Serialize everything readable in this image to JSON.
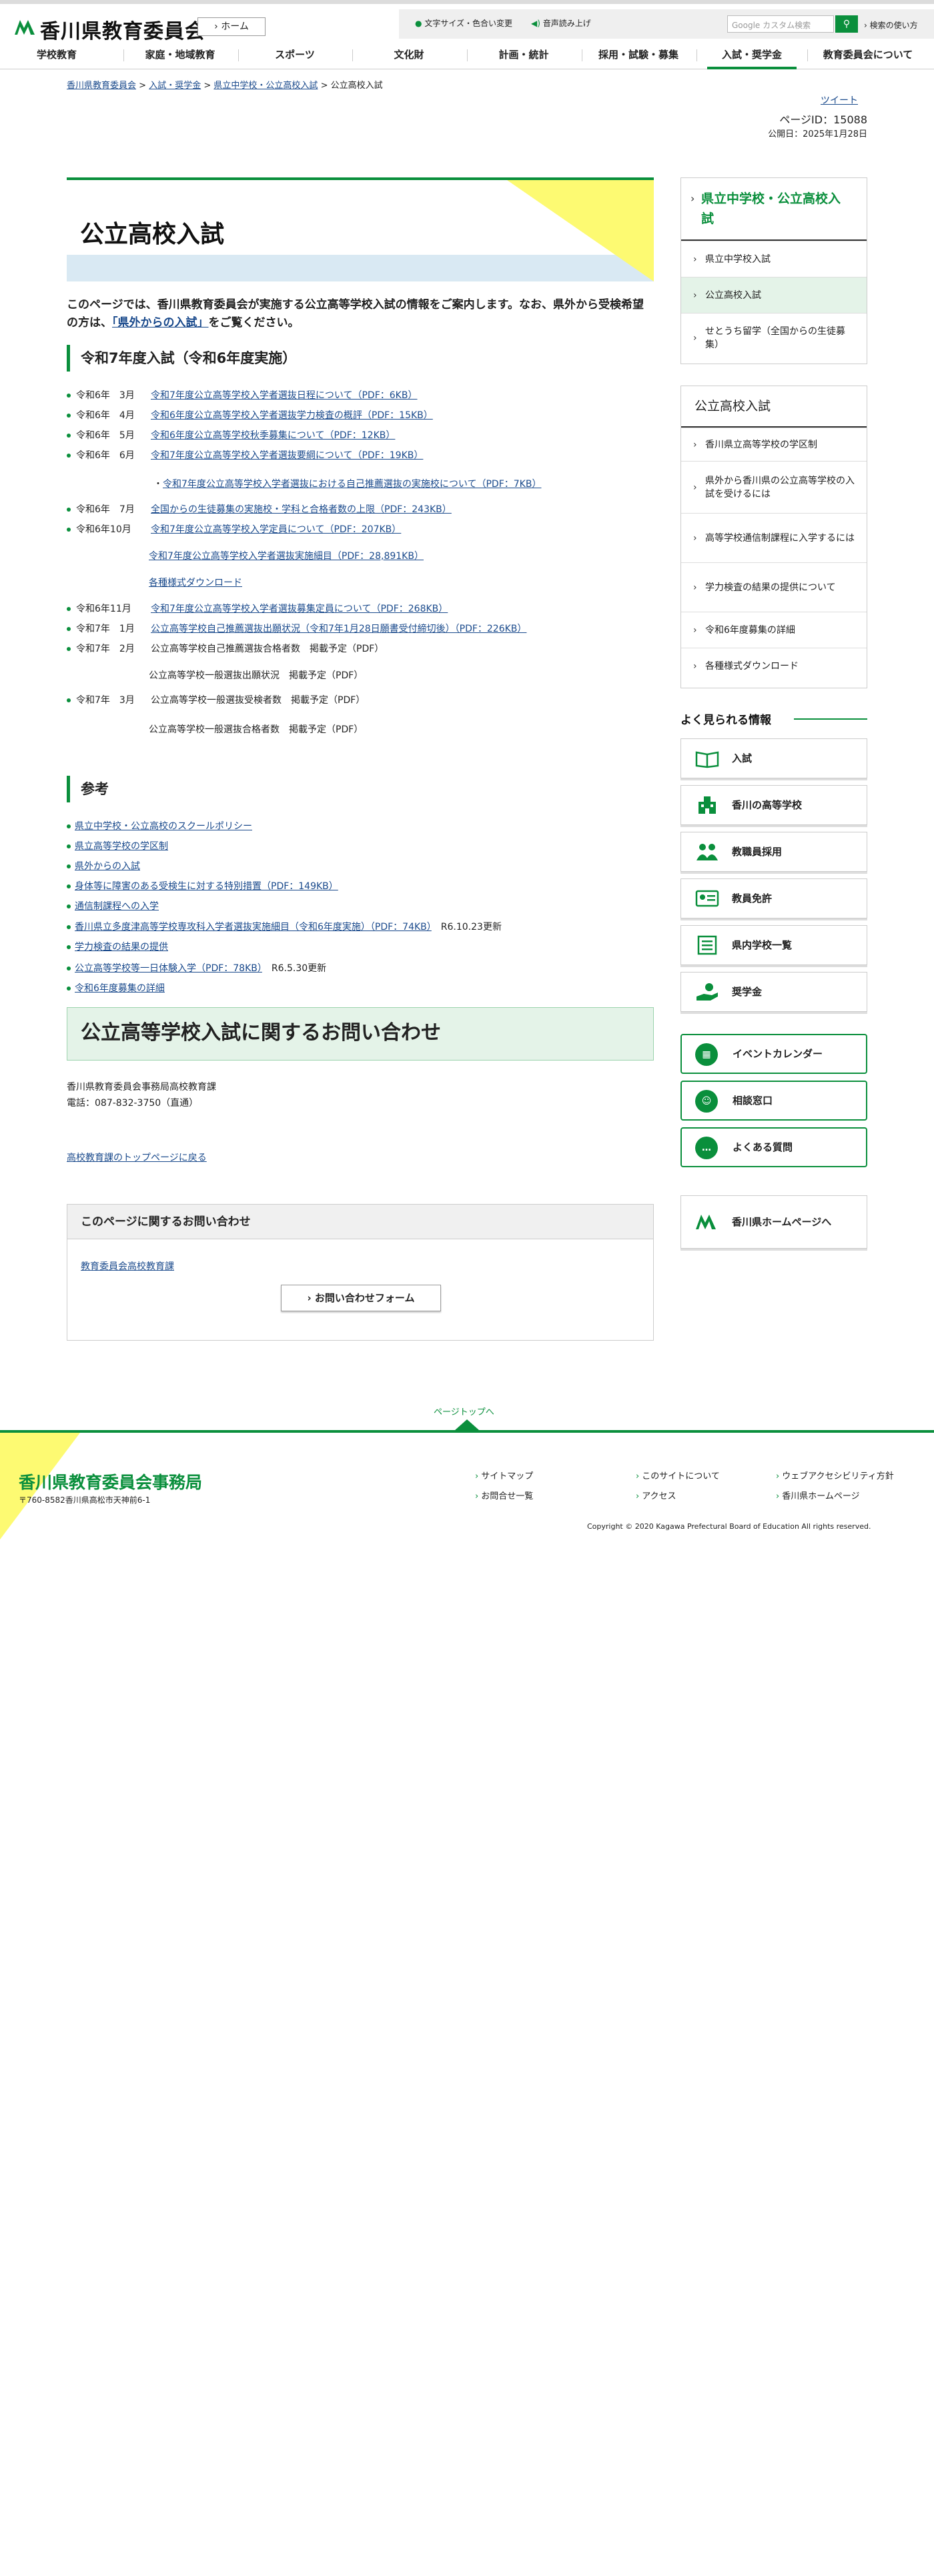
{
  "header": {
    "site_name": "香川県教育委員会",
    "home_label": "ホーム",
    "font_size_label": "文字サイズ・色合い変更",
    "audio_label": "音声読み上げ",
    "search_placeholder": "Google カスタム検索",
    "search_help": "検索の使い方"
  },
  "gnav": [
    "学校教育",
    "家庭・地域教育",
    "スポーツ",
    "文化財",
    "計画・統計",
    "採用・試験・募集",
    "入試・奨学金",
    "教育委員会について"
  ],
  "breadcrumb": {
    "items": [
      "香川県教育委員会",
      "入試・奨学金",
      "県立中学校・公立高校入試"
    ],
    "current": "公立高校入試",
    "sep": ">"
  },
  "meta": {
    "tweet": "ツイート",
    "page_id": "ページID：15088",
    "published": "公開日：2025年1月28日"
  },
  "page_title": "公立高校入試",
  "intro": {
    "text1": "このページでは、香川県教育委員会が実施する公立高等学校入試の情報をご案内します。なお、県外から受検希望の方は、",
    "link": "「県外からの入試」",
    "text2": "をご覧ください。"
  },
  "section1": {
    "heading": "令和7年度入試（令和6年度実施）",
    "rows": [
      {
        "date": "令和6年　3月",
        "link": "令和7年度公立高等学校入学者選抜日程について（PDF：6KB）"
      },
      {
        "date": "令和6年　4月",
        "link": "令和6年度公立高等学校入学者選抜学力検査の概評（PDF：15KB）"
      },
      {
        "date": "令和6年　5月",
        "link": "令和6年度公立高等学校秋季募集について（PDF：12KB）"
      },
      {
        "date": "令和6年　6月",
        "link": "令和7年度公立高等学校入学者選抜要綱について（PDF：19KB）"
      },
      {
        "date": "令和6年　7月",
        "link": "全国からの生徒募集の実施校・学科と合格者数の上限（PDF：243KB）"
      },
      {
        "date": "令和6年10月",
        "link": "令和7年度公立高等学校入学定員について（PDF：207KB）"
      },
      {
        "date": "令和6年11月",
        "link": "令和7年度公立高等学校入学者選抜募集定員について（PDF：268KB）"
      },
      {
        "date": "令和7年　1月",
        "link": "公立高等学校自己推薦選抜出願状況（令和7年1月28日願書受付締切後）（PDF：226KB）"
      },
      {
        "date": "令和7年　2月",
        "text": "公立高等学校自己推薦選抜合格者数　掲載予定（PDF）"
      },
      {
        "date": "令和7年　3月",
        "text": "公立高等学校一般選抜受検者数　掲載予定（PDF）"
      }
    ],
    "sub_june": "令和7年度公立高等学校入学者選抜における自己推薦選抜の実施校について（PDF：7KB）",
    "sub_oct_1": "令和7年度公立高等学校入学者選抜実施細目（PDF：28,891KB）",
    "sub_oct_2": "各種様式ダウンロード",
    "sub_feb": "公立高等学校一般選抜出願状況　掲載予定（PDF）",
    "sub_mar": "公立高等学校一般選抜合格者数　掲載予定（PDF）"
  },
  "section2": {
    "heading": "参考",
    "items": [
      {
        "link": "県立中学校・公立高校のスクールポリシー",
        "note": ""
      },
      {
        "link": "県立高等学校の学区制",
        "note": ""
      },
      {
        "link": "県外からの入試",
        "note": ""
      },
      {
        "link": "身体等に障害のある受検生に対する特別措置（PDF：149KB）",
        "note": ""
      },
      {
        "link": "通信制課程への入学",
        "note": ""
      },
      {
        "link": "香川県立多度津高等学校専攻科入学者選抜実施細目（令和6年度実施）（PDF：74KB）",
        "note": "R6.10.23更新"
      },
      {
        "link": "学力検査の結果の提供",
        "note": ""
      },
      {
        "link": "公立高等学校等一日体験入学（PDF：78KB）",
        "note": "R6.5.30更新"
      },
      {
        "link": "令和6年度募集の詳細",
        "note": ""
      }
    ]
  },
  "contact": {
    "heading": "公立高等学校入試に関するお問い合わせ",
    "org": "香川県教育委員会事務局高校教育課",
    "tel": "電話：087-832-3750（直通）",
    "back_link": "高校教育課のトップページに戻る"
  },
  "inquiry": {
    "heading": "このページに関するお問い合わせ",
    "link": "教育委員会高校教育課",
    "button": "お問い合わせフォーム"
  },
  "sidebar": {
    "box1": {
      "heading": "県立中学校・公立高校入試",
      "items": [
        "県立中学校入試",
        "公立高校入試",
        "せとうち留学（全国からの生徒募集）"
      ],
      "active_index": 1
    },
    "box2": {
      "heading": "公立高校入試",
      "items": [
        "香川県立高等学校の学区制",
        "県外から香川県の公立高等学校の入試を受けるには",
        "高等学校通信制課程に入学するには",
        "学力検査の結果の提供について",
        "令和6年度募集の詳細",
        "各種様式ダウンロード"
      ]
    },
    "freq_title": "よく見られる情報",
    "freq": [
      {
        "label": "入試",
        "icon": "book-icon"
      },
      {
        "label": "香川の高等学校",
        "icon": "school-building-icon"
      },
      {
        "label": "教職員採用",
        "icon": "people-icon"
      },
      {
        "label": "教員免許",
        "icon": "license-card-icon"
      },
      {
        "label": "県内学校一覧",
        "icon": "list-icon"
      },
      {
        "label": "奨学金",
        "icon": "hand-coin-icon"
      }
    ],
    "green": [
      {
        "label": "イベントカレンダー",
        "icon": "calendar-icon"
      },
      {
        "label": "相談窓口",
        "icon": "consult-icon"
      },
      {
        "label": "よくある質問",
        "icon": "chat-icon"
      }
    ],
    "kagawa": "香川県ホームページへ"
  },
  "footer": {
    "pagetop": "ページトップへ",
    "org": "香川県教育委員会事務局",
    "address": "〒760-8582香川県高松市天神前6-1",
    "links": [
      "サイトマップ",
      "お問合せ一覧",
      "このサイトについて",
      "アクセス",
      "ウェブアクセシビリティ方針",
      "香川県ホームページ"
    ],
    "copyright": "Copyright © 2020 Kagawa Prefectural Board of Education All rights reserved."
  },
  "colors": {
    "accent": "#0a8f3c",
    "link": "#1a4a8c",
    "yellow": "#fdfa72"
  }
}
